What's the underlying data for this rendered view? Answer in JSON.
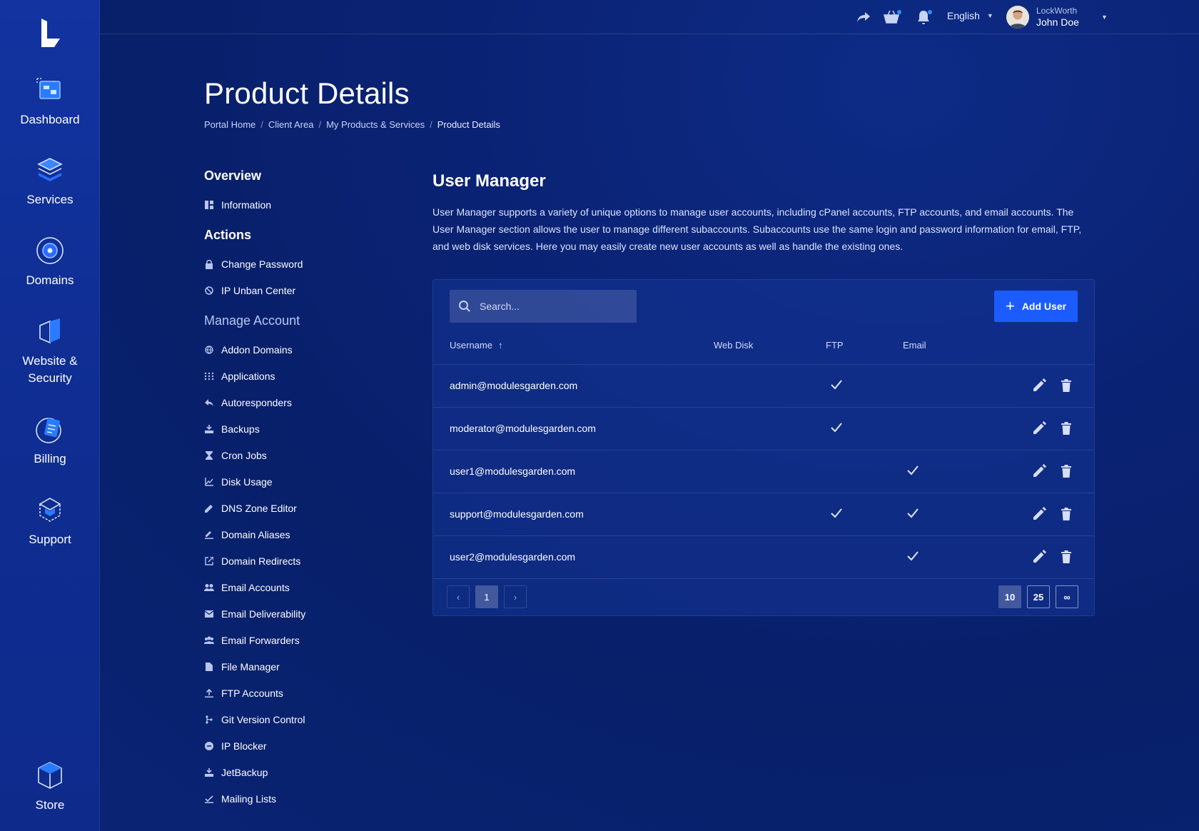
{
  "rail": {
    "items": [
      {
        "label": "Dashboard",
        "icon": "dashboard-icon"
      },
      {
        "label": "Services",
        "icon": "services-icon"
      },
      {
        "label": "Domains",
        "icon": "domains-icon"
      },
      {
        "label": "Website &",
        "label2": "Security",
        "icon": "website-security-icon"
      },
      {
        "label": "Billing",
        "icon": "billing-icon"
      },
      {
        "label": "Support",
        "icon": "support-icon"
      }
    ],
    "store": {
      "label": "Store",
      "icon": "store-icon"
    }
  },
  "topbar": {
    "language": "English",
    "company": "LockWorth",
    "user_name": "John Doe"
  },
  "header": {
    "title": "Product Details",
    "breadcrumb": [
      "Portal Home",
      "Client Area",
      "My Products & Services",
      "Product Details"
    ]
  },
  "side_menu": {
    "overview": {
      "heading": "Overview",
      "items": [
        {
          "label": "Information",
          "icon": "information-icon"
        }
      ]
    },
    "actions": {
      "heading": "Actions",
      "items": [
        {
          "label": "Change Password",
          "icon": "lock-icon"
        },
        {
          "label": "IP Unban Center",
          "icon": "ban-icon"
        }
      ]
    },
    "manage": {
      "heading": "Manage Account",
      "items": [
        {
          "label": "Addon Domains",
          "icon": "globe-icon"
        },
        {
          "label": "Applications",
          "icon": "grid-dots-icon"
        },
        {
          "label": "Autoresponders",
          "icon": "reply-icon"
        },
        {
          "label": "Backups",
          "icon": "backup-icon"
        },
        {
          "label": "Cron Jobs",
          "icon": "hourglass-icon"
        },
        {
          "label": "Disk Usage",
          "icon": "line-chart-icon"
        },
        {
          "label": "DNS Zone Editor",
          "icon": "pencil-icon"
        },
        {
          "label": "Domain Aliases",
          "icon": "pen-line-icon"
        },
        {
          "label": "Domain Redirects",
          "icon": "external-link-icon"
        },
        {
          "label": "Email Accounts",
          "icon": "users-icon"
        },
        {
          "label": "Email Deliverability",
          "icon": "envelope-icon"
        },
        {
          "label": "Email Forwarders",
          "icon": "group-icon"
        },
        {
          "label": "File Manager",
          "icon": "file-icon"
        },
        {
          "label": "FTP Accounts",
          "icon": "upload-icon"
        },
        {
          "label": "Git Version Control",
          "icon": "git-branch-icon"
        },
        {
          "label": "IP Blocker",
          "icon": "minus-circle-icon"
        },
        {
          "label": "JetBackup",
          "icon": "backup-icon"
        },
        {
          "label": "Mailing Lists",
          "icon": "check-line-icon"
        }
      ]
    }
  },
  "user_manager": {
    "title": "User Manager",
    "description": "User Manager supports a variety of unique options to manage user accounts, including cPanel accounts, FTP accounts, and email accounts. The User Manager section allows the user to manage different subaccounts. Subaccounts use the same login and password information for email, FTP, and web disk services. Here you may easily create new user accounts as well as handle the existing ones.",
    "search_placeholder": "Search...",
    "add_button": "Add User",
    "columns": [
      "Username",
      "Web Disk",
      "FTP",
      "Email"
    ],
    "rows": [
      {
        "username": "admin@modulesgarden.com",
        "web_disk": false,
        "ftp": true,
        "email": false
      },
      {
        "username": "moderator@modulesgarden.com",
        "web_disk": false,
        "ftp": true,
        "email": false
      },
      {
        "username": "user1@modulesgarden.com",
        "web_disk": false,
        "ftp": false,
        "email": true
      },
      {
        "username": "support@modulesgarden.com",
        "web_disk": false,
        "ftp": true,
        "email": true
      },
      {
        "username": "user2@modulesgarden.com",
        "web_disk": false,
        "ftp": false,
        "email": true
      }
    ],
    "pagination": {
      "prev": "‹",
      "next": "›",
      "current_page": "1",
      "page_sizes": [
        "10",
        "25",
        "∞"
      ],
      "selected_size": "10"
    }
  },
  "colors": {
    "accent": "#1a5cff",
    "background": "#0a2273",
    "rail": "#1233a0"
  }
}
